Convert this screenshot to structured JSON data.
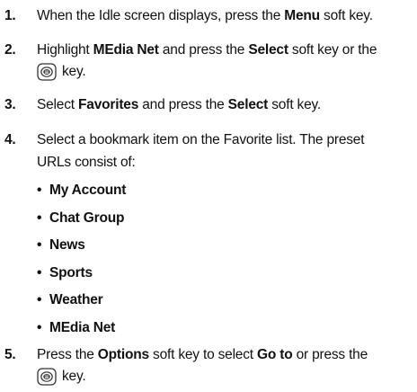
{
  "steps": [
    {
      "number": "1.",
      "pre": "When the Idle screen displays, press the ",
      "bold1": "Menu",
      "post": " soft key."
    },
    {
      "number": "2.",
      "pre": "Highlight ",
      "bold1": "MEdia Net",
      "mid": " and press the ",
      "bold2": "Select",
      "post": " soft key or the",
      "line2_post": "key.",
      "icon": "ok-key-icon"
    },
    {
      "number": "3.",
      "pre": "Select ",
      "bold1": "Favorites",
      "mid": " and press the ",
      "bold2": "Select",
      "post": " soft key."
    },
    {
      "number": "4.",
      "line1": "Select a bookmark item on the Favorite list. The preset",
      "line2": "URLs consist of:",
      "bullets": [
        "My Account",
        "Chat Group",
        "News",
        "Sports",
        "Weather",
        "MEdia Net"
      ]
    },
    {
      "number": "5.",
      "pre": "Press the ",
      "bold1": "Options",
      "mid": " soft key to select ",
      "bold2": "Go to",
      "post": " or press the",
      "line2_post": "key.",
      "icon": "ok-key-icon"
    }
  ],
  "bullet_char": "•"
}
